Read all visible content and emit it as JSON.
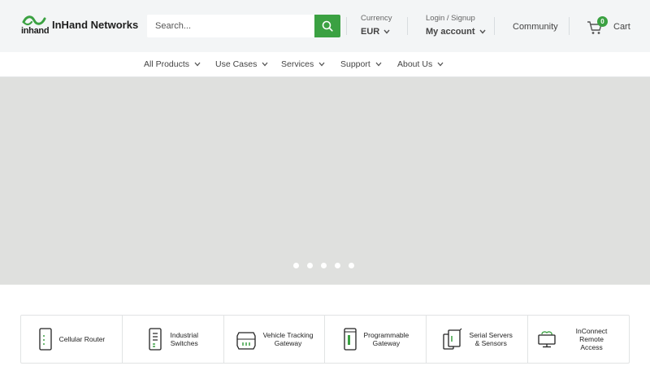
{
  "brand": {
    "name": "InHand Networks",
    "mark_text": "inhand"
  },
  "search": {
    "placeholder": "Search..."
  },
  "currency": {
    "label": "Currency",
    "value": "EUR"
  },
  "account": {
    "label": "Login / Signup",
    "value": "My account"
  },
  "community": "Community",
  "cart": {
    "label": "Cart",
    "count": "0"
  },
  "nav": [
    "All Products",
    "Use Cases",
    "Services",
    "Support",
    "About Us"
  ],
  "hero": {
    "slide_count": 5
  },
  "categories": [
    {
      "label_lines": [
        "Cellular Router"
      ],
      "icon": "cellular-router-icon"
    },
    {
      "label_lines": [
        "Industrial",
        "Switches"
      ],
      "icon": "industrial-switch-icon"
    },
    {
      "label_lines": [
        "Vehicle Tracking",
        "Gateway"
      ],
      "icon": "vehicle-tracking-icon"
    },
    {
      "label_lines": [
        "Programmable",
        "Gateway"
      ],
      "icon": "programmable-gateway-icon"
    },
    {
      "label_lines": [
        "Serial Servers",
        "& Sensors"
      ],
      "icon": "serial-server-icon"
    },
    {
      "label_lines": [
        "InConnect Remote",
        "Access"
      ],
      "icon": "remote-access-icon"
    }
  ],
  "colors": {
    "accent": "#3ba142",
    "header_bg": "#f3f5f6",
    "hero_bg": "#dfe0de"
  }
}
